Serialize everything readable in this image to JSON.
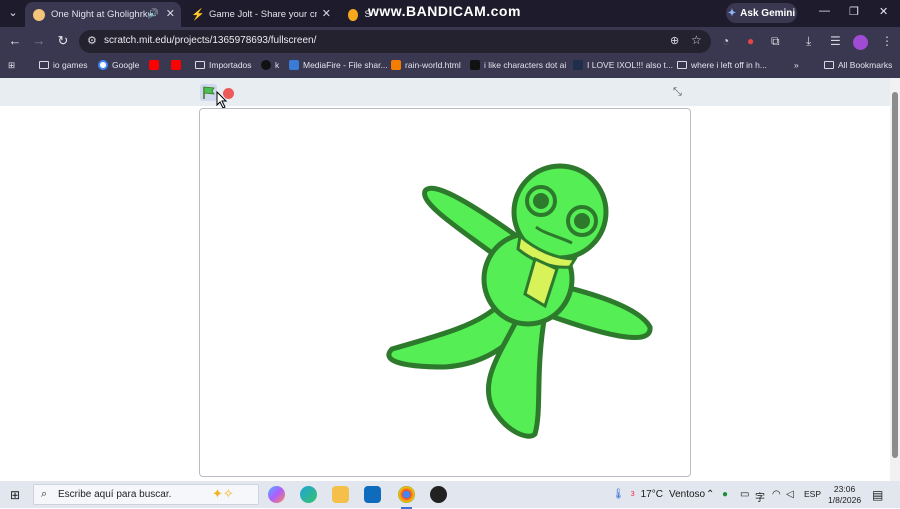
{
  "tabs": [
    {
      "title": "One Night at Gholighrkgh",
      "active": true,
      "audio": true
    },
    {
      "title": "Game Jolt - Share your creation",
      "active": false
    },
    {
      "title": "S",
      "active": false
    }
  ],
  "watermark": "www.BANDICAM.com",
  "gemini_label": "Ask Gemini",
  "address": {
    "url": "scratch.mit.edu/projects/1365978693/fullscreen/"
  },
  "bookmarks": [
    "io games",
    "Google",
    "",
    "",
    "Importados",
    "k",
    "MediaFire - File shar...",
    "rain-world.html",
    "i like characters dot ai",
    "I LOVE IXOL!!! also t...",
    "where i left off in h..."
  ],
  "all_bookmarks": "All Bookmarks",
  "taskbar": {
    "search_placeholder": "Escribe aquí para buscar.",
    "weather_temp": "17°C",
    "weather_desc": "Ventoso",
    "weather_badge": "3",
    "lang": "ESP",
    "time": "23:06",
    "date": "1/8/2026"
  },
  "colors": {
    "chrome_dark": "#1d1b2c",
    "chrome_mid": "#3a3850",
    "character_green": "#55ee55",
    "character_outline": "#2d7a2d",
    "scarf": "#d8f25a"
  }
}
